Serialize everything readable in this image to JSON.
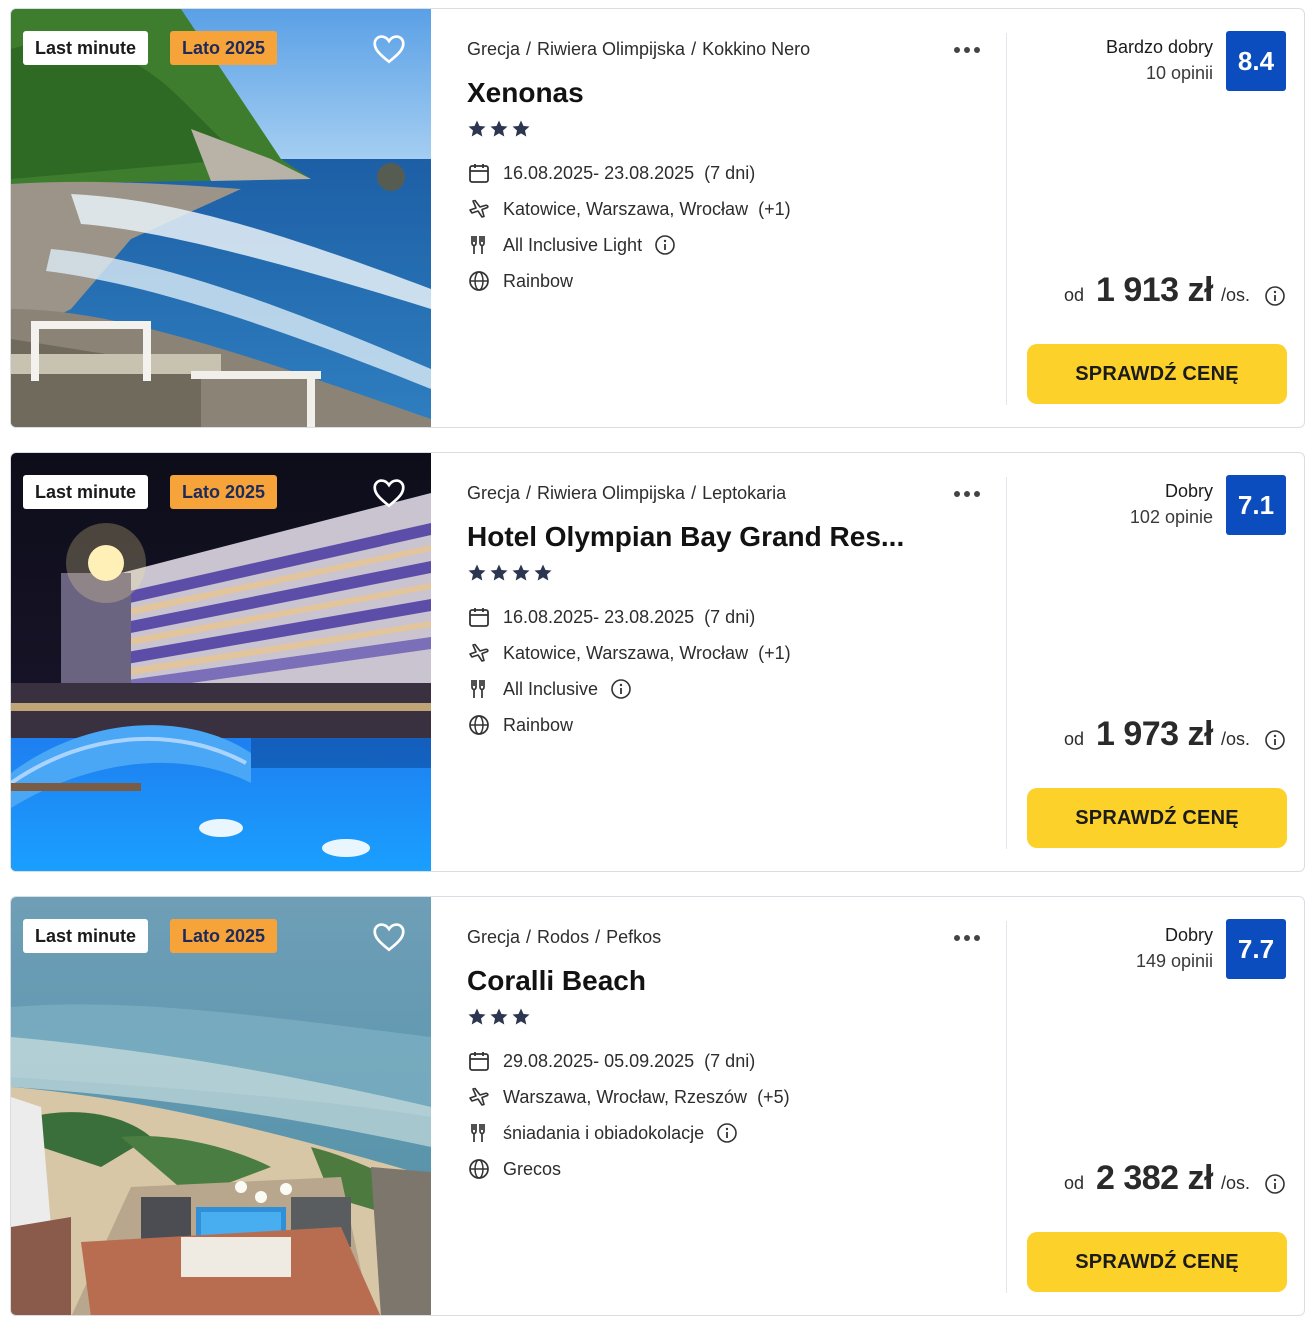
{
  "offers": [
    {
      "badges": {
        "primary": "Last minute",
        "season": "Lato 2025"
      },
      "breadcrumb": {
        "country": "Grecja",
        "region": "Riwiera Olimpijska",
        "city": "Kokkino Nero"
      },
      "title": "Xenonas",
      "stars": 3,
      "dates": "16.08.2025- 23.08.2025",
      "duration": "(7 dni)",
      "departures": "Katowice, Warszawa, Wrocław",
      "departures_extra": "(+1)",
      "board": "All Inclusive Light",
      "operator": "Rainbow",
      "rating": {
        "label": "Bardzo dobry",
        "count": "10 opinii",
        "score": "8.4"
      },
      "price": {
        "prefix": "od",
        "amount": "1 913 zł",
        "suffix": "/os."
      },
      "cta": "SPRAWDŹ CENĘ"
    },
    {
      "badges": {
        "primary": "Last minute",
        "season": "Lato 2025"
      },
      "breadcrumb": {
        "country": "Grecja",
        "region": "Riwiera Olimpijska",
        "city": "Leptokaria"
      },
      "title": "Hotel Olympian Bay Grand Res...",
      "stars": 4,
      "dates": "16.08.2025- 23.08.2025",
      "duration": "(7 dni)",
      "departures": "Katowice, Warszawa, Wrocław",
      "departures_extra": "(+1)",
      "board": "All Inclusive",
      "operator": "Rainbow",
      "rating": {
        "label": "Dobry",
        "count": "102 opinie",
        "score": "7.1"
      },
      "price": {
        "prefix": "od",
        "amount": "1 973 zł",
        "suffix": "/os."
      },
      "cta": "SPRAWDŹ CENĘ"
    },
    {
      "badges": {
        "primary": "Last minute",
        "season": "Lato 2025"
      },
      "breadcrumb": {
        "country": "Grecja",
        "region": "Rodos",
        "city": "Pefkos"
      },
      "title": "Coralli Beach",
      "stars": 3,
      "dates": "29.08.2025- 05.09.2025",
      "duration": "(7 dni)",
      "departures": "Warszawa, Wrocław, Rzeszów",
      "departures_extra": "(+5)",
      "board": "śniadania i obiadokolacje",
      "operator": "Grecos",
      "rating": {
        "label": "Dobry",
        "count": "149 opinii",
        "score": "7.7"
      },
      "price": {
        "prefix": "od",
        "amount": "2 382 zł",
        "suffix": "/os."
      },
      "cta": "SPRAWDŹ CENĘ"
    }
  ],
  "colors": {
    "score_bg": "#0b4dbf",
    "cta_bg": "#fcd12a",
    "season_badge": "#f6a43a",
    "star": "#2c3650"
  },
  "icons": [
    "heart-icon",
    "more-dots-icon",
    "star-icon",
    "calendar-icon",
    "plane-icon",
    "cutlery-icon",
    "info-icon",
    "globe-icon"
  ]
}
